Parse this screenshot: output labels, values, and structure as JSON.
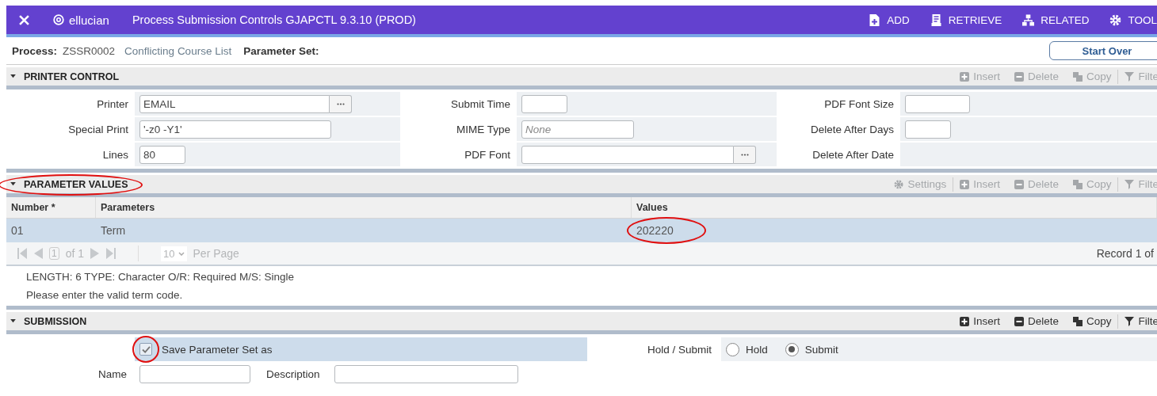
{
  "header": {
    "brand": "ellucian",
    "title": "Process Submission Controls GJAPCTL 9.3.10 (PROD)",
    "actions": [
      {
        "label": "ADD",
        "kind": "add"
      },
      {
        "label": "RETRIEVE",
        "kind": "retrieve"
      },
      {
        "label": "RELATED",
        "kind": "related"
      },
      {
        "label": "TOOL",
        "kind": "tools"
      }
    ]
  },
  "process": {
    "label": "Process:",
    "code": "ZSSR0002",
    "name": "Conflicting Course List",
    "parameter_set_label": "Parameter Set:",
    "start_over": "Start Over"
  },
  "printer_control": {
    "title": "PRINTER CONTROL",
    "tools": [
      {
        "label": "Insert",
        "kind": "insert",
        "disabled": true
      },
      {
        "label": "Delete",
        "kind": "delete",
        "disabled": true
      },
      {
        "label": "Copy",
        "kind": "copy",
        "disabled": true
      },
      {
        "label": "Filte",
        "kind": "filter",
        "disabled": true
      }
    ],
    "rows": [
      [
        {
          "label": "Printer",
          "kind": "input",
          "value": "EMAIL",
          "lookup": true
        },
        {
          "label": "Submit Time",
          "kind": "input",
          "lookup": false
        },
        {
          "label": "PDF Font Size",
          "kind": "input",
          "lookup": false
        }
      ],
      [
        {
          "label": "Special Print",
          "kind": "input",
          "value": "'-z0 -Y1'",
          "lookup": false
        },
        {
          "label": "MIME Type",
          "kind": "input",
          "placeholder": "None",
          "lookup": false
        },
        {
          "label": "Delete After Days",
          "kind": "input",
          "lookup": false
        }
      ],
      [
        {
          "label": "Lines",
          "kind": "input",
          "value": "80",
          "lookup": false
        },
        {
          "label": "PDF Font",
          "kind": "input",
          "lookup": true
        },
        {
          "label": "Delete After Date",
          "kind": "label"
        }
      ]
    ]
  },
  "parameter_values": {
    "title": "PARAMETER VALUES",
    "circled": true,
    "tools": [
      {
        "label": "Settings",
        "kind": "settings",
        "disabled": true
      },
      {
        "label": "Insert",
        "kind": "insert",
        "disabled": true
      },
      {
        "label": "Delete",
        "kind": "delete",
        "disabled": true
      },
      {
        "label": "Copy",
        "kind": "copy",
        "disabled": true
      },
      {
        "label": "Filte",
        "kind": "filter",
        "disabled": true
      }
    ],
    "columns": [
      "Number *",
      "Parameters",
      "Values"
    ],
    "rows": [
      {
        "cells": [
          {
            "text": "01",
            "circled": false
          },
          {
            "text": "Term",
            "circled": false
          },
          {
            "text": "202220",
            "circled": true
          }
        ],
        "selected": true
      }
    ],
    "pager": {
      "page": "1",
      "of": "of 1",
      "per_page": "10",
      "per_page_label": "Per Page",
      "record": "Record 1 of"
    },
    "info": [
      "LENGTH: 6 TYPE: Character O/R: Required M/S: Single",
      "Please enter the valid term code."
    ]
  },
  "submission": {
    "title": "SUBMISSION",
    "tools": [
      {
        "label": "Insert",
        "kind": "insert",
        "disabled": false
      },
      {
        "label": "Delete",
        "kind": "delete",
        "disabled": false
      },
      {
        "label": "Copy",
        "kind": "copy",
        "disabled": false
      },
      {
        "label": "Filte",
        "kind": "filter",
        "disabled": false
      }
    ],
    "save": {
      "label": "Save Parameter Set as",
      "checked": true,
      "circled": true
    },
    "hold_submit_label": "Hold / Submit",
    "options": [
      {
        "label": "Hold",
        "selected": false
      },
      {
        "label": "Submit",
        "selected": true
      }
    ],
    "name_label": "Name",
    "description_label": "Description"
  }
}
